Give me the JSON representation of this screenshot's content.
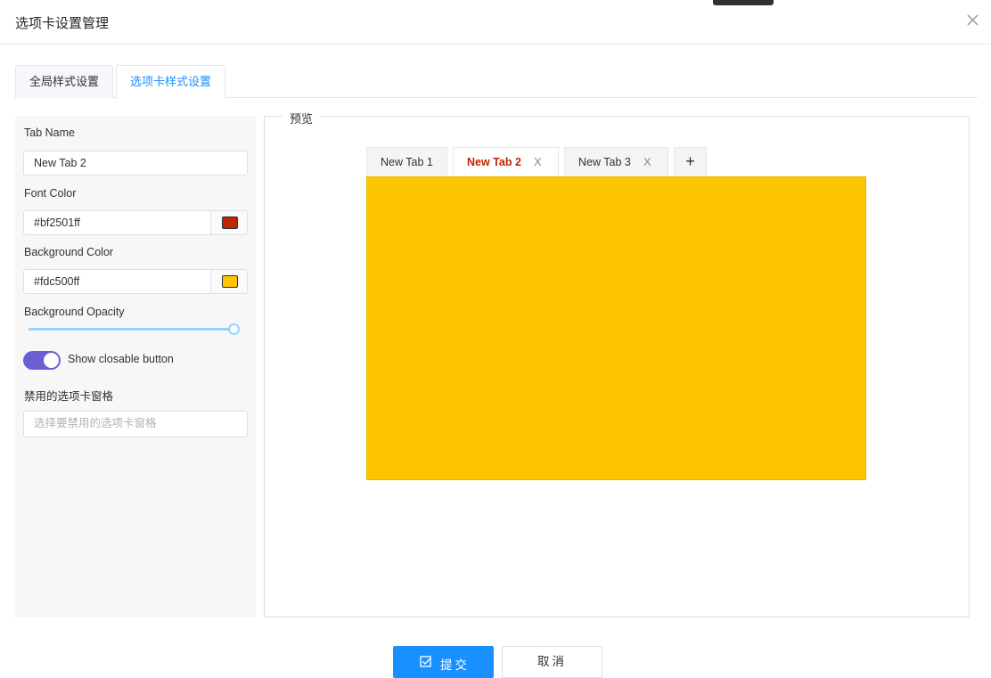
{
  "dialog": {
    "title": "选项卡设置管理"
  },
  "settings_tabs": [
    {
      "label": "全局样式设置"
    },
    {
      "label": "选项卡样式设置"
    }
  ],
  "form": {
    "tab_name_label": "Tab Name",
    "tab_name_value": "New Tab 2",
    "font_color_label": "Font Color",
    "font_color_value": "#bf2501ff",
    "font_color_swatch": "#bf2501",
    "bg_color_label": "Background Color",
    "bg_color_value": "#fdc500ff",
    "bg_color_swatch": "#fdc500",
    "bg_opacity_label": "Background Opacity",
    "bg_opacity_value": 1.0,
    "closable_label": "Show closable button",
    "closable_on": true,
    "disabled_tabs_label": "禁用的选项卡窗格",
    "disabled_tabs_placeholder": "选择要禁用的选项卡窗格"
  },
  "preview": {
    "legend": "预览",
    "tabs": [
      {
        "label": "New Tab 1",
        "closable": false
      },
      {
        "label": "New Tab 2",
        "closable": true,
        "active": true
      },
      {
        "label": "New Tab 3",
        "closable": true
      }
    ],
    "close_glyph": "X",
    "add_glyph": "+",
    "active_font_color": "#bf2501",
    "pane_color": "#fdc500"
  },
  "actions": {
    "submit_label": "提交",
    "cancel_label": "取消"
  },
  "icons": {
    "dialog_close": "close-icon",
    "submit": "check-square-icon"
  }
}
